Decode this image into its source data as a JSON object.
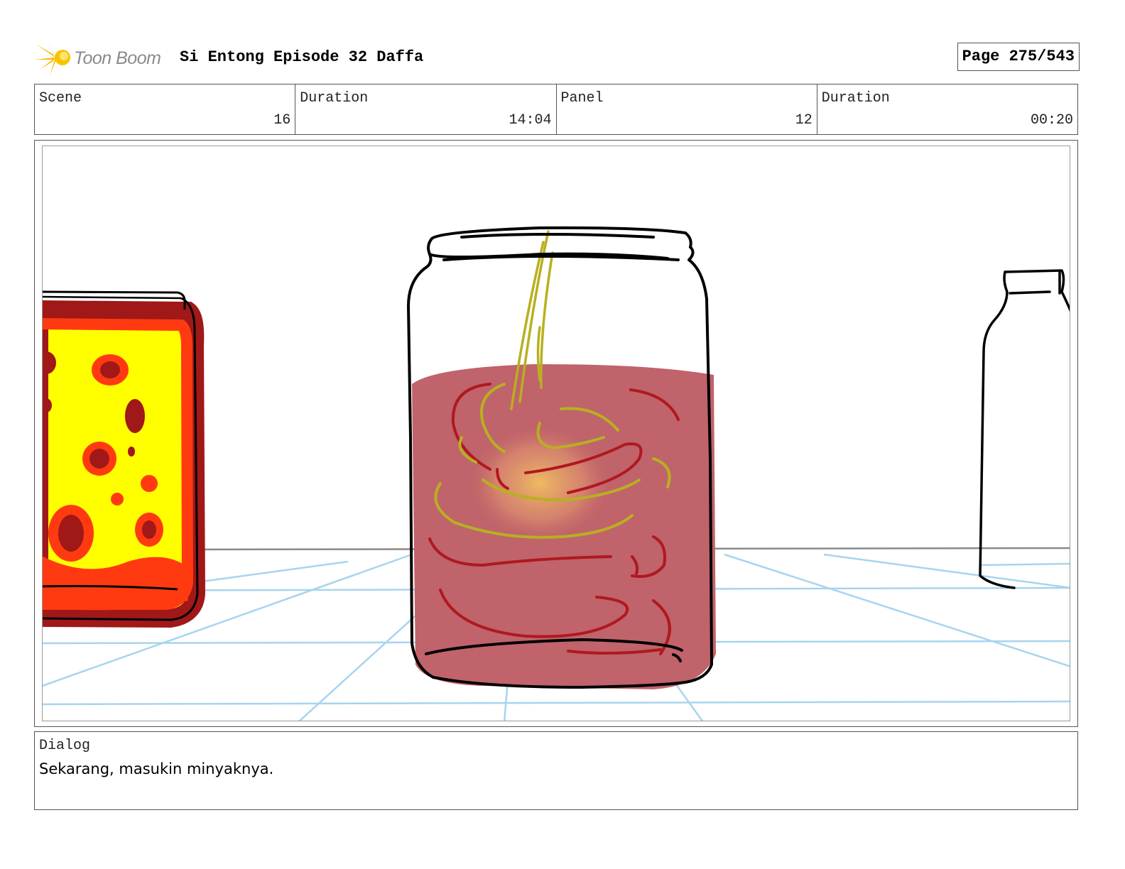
{
  "header": {
    "logo_text": "Toon Boom",
    "project_title": "Si Entong Episode 32 Daffa",
    "page_label": "Page 275/543"
  },
  "info": [
    {
      "label": "Scene",
      "value": "16"
    },
    {
      "label": "Duration",
      "value": "14:04"
    },
    {
      "label": "Panel",
      "value": "12"
    },
    {
      "label": "Duration",
      "value": "00:20"
    }
  ],
  "dialog": {
    "label": "Dialog",
    "text": "Sekarang, masukin minyaknya."
  },
  "colors": {
    "liquid": "#c0636a",
    "swirl_red": "#b01820",
    "swirl_oil": "#b8b020",
    "grid": "#a8d4ee",
    "jar_yellow": "#ffff00",
    "jar_orange": "#ff3a10",
    "jar_darkred": "#a01818"
  }
}
